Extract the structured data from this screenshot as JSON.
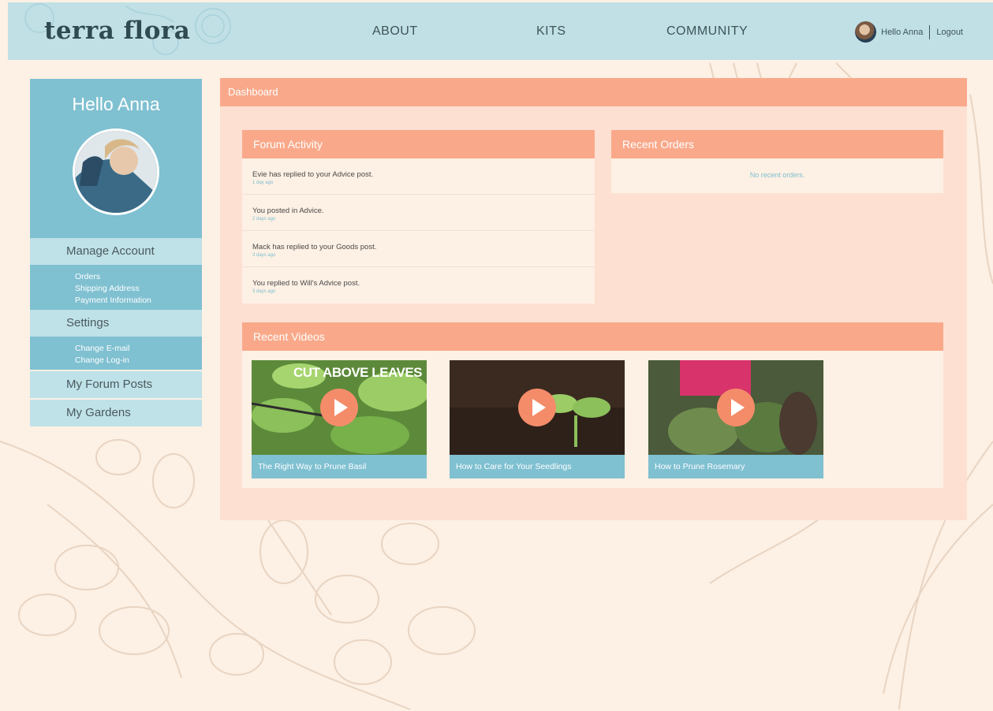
{
  "brand": {
    "name": "terra flora"
  },
  "nav": {
    "items": [
      "ABOUT",
      "KITS",
      "COMMUNITY"
    ]
  },
  "user_area": {
    "greeting": "Hello Anna",
    "logout_label": "Logout"
  },
  "sidebar": {
    "title": "Hello Anna",
    "manage_account": {
      "label": "Manage Account",
      "items": [
        "Orders",
        "Shipping Address",
        "Payment Information"
      ]
    },
    "settings": {
      "label": "Settings",
      "items": [
        "Change E-mail",
        "Change Log-in"
      ]
    },
    "forum_posts_label": "My Forum Posts",
    "gardens_label": "My Gardens"
  },
  "main": {
    "title": "Dashboard",
    "forum": {
      "title": "Forum Activity",
      "items": [
        {
          "text": "Evie has replied to your Advice post.",
          "time": "1 day ago"
        },
        {
          "text": "You posted in Advice.",
          "time": "2 days ago"
        },
        {
          "text": "Mack has replied to your Goods post.",
          "time": "3 days ago"
        },
        {
          "text": "You replied to Will's Advice post.",
          "time": "3 days ago"
        }
      ]
    },
    "orders": {
      "title": "Recent Orders",
      "empty_text": "No recent orders."
    },
    "videos": {
      "title": "Recent Videos",
      "items": [
        {
          "caption": "The Right Way to Prune Basil",
          "thumb_text": "CUT ABOVE LEAVES"
        },
        {
          "caption": "How to Care for Your Seedlings"
        },
        {
          "caption": "How to Prune Rosemary"
        }
      ]
    }
  },
  "colors": {
    "header": "#c0e0e6",
    "accent": "#f9a98a",
    "sidebar": "#7fc0d1",
    "panel": "#fde0d2",
    "background": "#fdf0e4",
    "play": "#f48c6a"
  }
}
